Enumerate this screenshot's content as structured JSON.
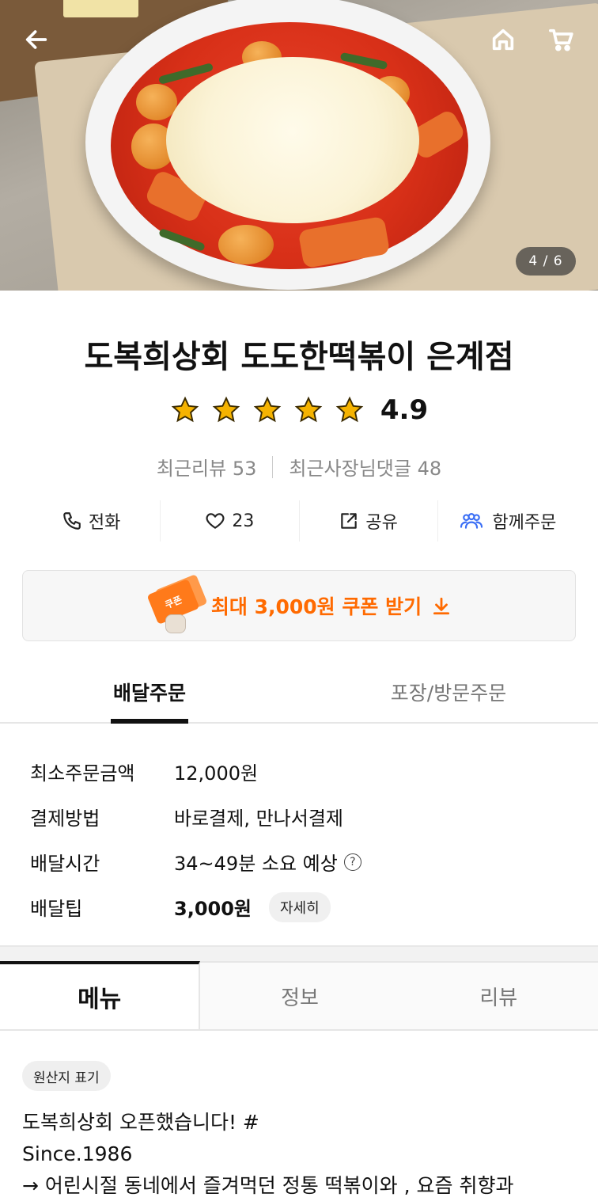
{
  "hero": {
    "counter": "4 / 6",
    "back_icon": "arrow-left-icon",
    "home_icon": "home-icon",
    "cart_icon": "cart-icon"
  },
  "store": {
    "name": "도복희상회 도도한떡볶이 은계점",
    "rating": "4.9",
    "stars": 5,
    "recent_reviews": "최근리뷰 53",
    "owner_replies": "최근사장님댓글 48"
  },
  "actions": {
    "call": "전화",
    "likes": "23",
    "share": "공유",
    "group_order": "함께주문"
  },
  "coupon": {
    "icon_text": "쿠폰",
    "label": "최대 3,000원 쿠폰 받기",
    "accent_color": "#ff6a00"
  },
  "order_tabs": {
    "delivery": "배달주문",
    "pickup": "포장/방문주문"
  },
  "info": {
    "min_order_label": "최소주문금액",
    "min_order_value": "12,000원",
    "payment_label": "결제방법",
    "payment_value": "바로결제, 만나서결제",
    "delivery_time_label": "배달시간",
    "delivery_time_value": "34~49분 소요 예상",
    "delivery_tip_label": "배달팁",
    "delivery_tip_value": "3,000원",
    "detail_button": "자세히"
  },
  "menu_tabs": {
    "menu": "메뉴",
    "info": "정보",
    "review": "리뷰"
  },
  "origin_badge": "원산지 표기",
  "description": {
    "line1": "도복희상회 오픈했습니다! #",
    "line2": "Since.1986",
    "line3": "→ 어린시절 동네에서 즐겨먹던 정통 떡볶이와 , 요즘 취향과"
  },
  "colors": {
    "star": "#f5b301",
    "group_order_icon": "#3b6ff5"
  }
}
